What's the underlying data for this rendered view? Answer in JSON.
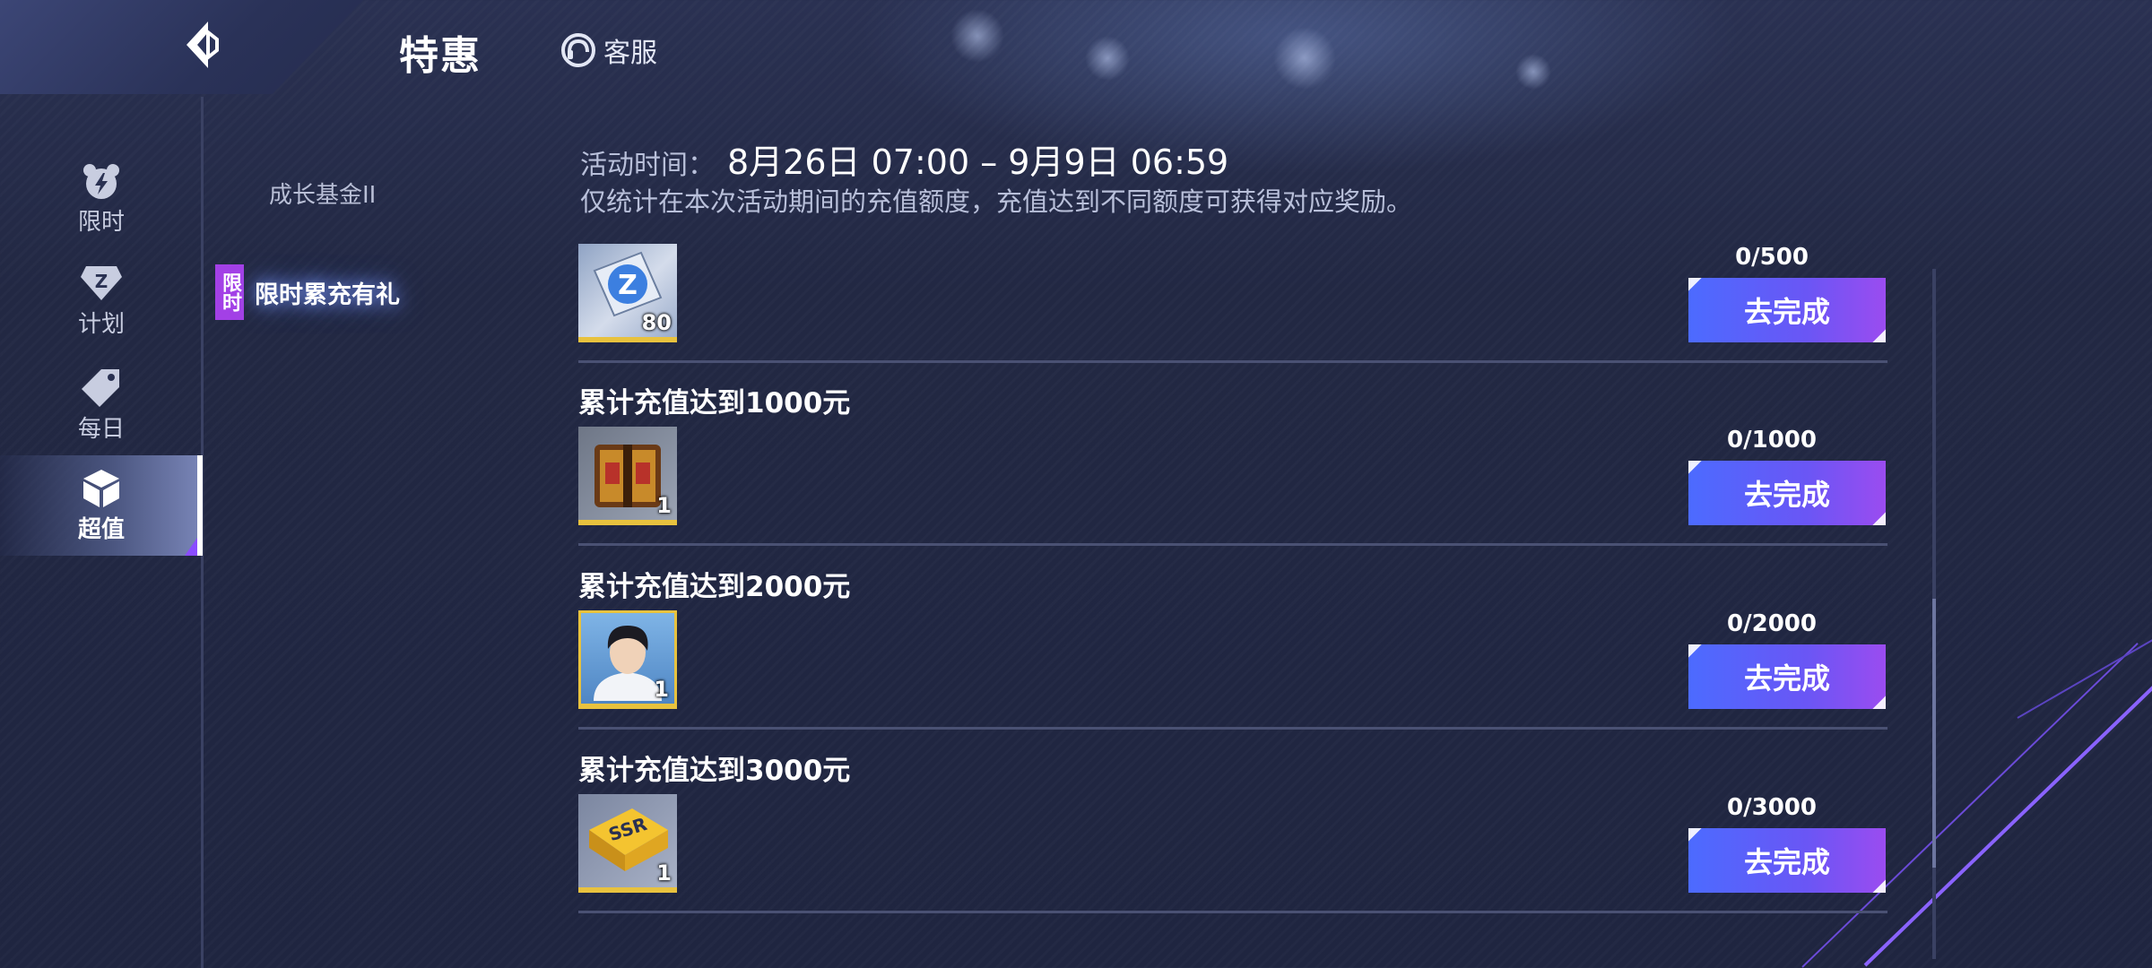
{
  "header": {
    "title": "特惠",
    "service_label": "客服"
  },
  "tabs": [
    {
      "label": "限时",
      "icon": "lightning-bear-icon",
      "active": false
    },
    {
      "label": "计划",
      "icon": "diamond-z-icon",
      "active": false
    },
    {
      "label": "每日",
      "icon": "tag-icon",
      "active": false
    },
    {
      "label": "超值",
      "icon": "cube-icon",
      "active": true
    }
  ],
  "submenu": {
    "items": [
      {
        "label": "成长基金II",
        "active": false
      },
      {
        "label": "限时累充有礼",
        "active": true,
        "badge": "限时"
      }
    ]
  },
  "event": {
    "time_label": "活动时间：",
    "time_value": "8月26日 07:00 – 9月9日 06:59",
    "description": "仅统计在本次活动期间的充值额度，充值达到不同额度可获得对应奖励。"
  },
  "tasks": [
    {
      "title": "",
      "reward": {
        "icon": "z-card-icon",
        "count": "80"
      },
      "progress": "0/500",
      "button": "去完成"
    },
    {
      "title": "累计充值达到1000元",
      "reward": {
        "icon": "treasure-chest-icon",
        "count": "1"
      },
      "progress": "0/1000",
      "button": "去完成"
    },
    {
      "title": "累计充值达到2000元",
      "reward": {
        "icon": "player-portrait-icon",
        "count": "1"
      },
      "progress": "0/2000",
      "button": "去完成"
    },
    {
      "title": "累计充值达到3000元",
      "reward": {
        "icon": "ssr-case-icon",
        "count": "1"
      },
      "progress": "0/3000",
      "button": "去完成"
    }
  ],
  "colors": {
    "accent_blue": "#4c6bff",
    "accent_purple": "#9b4cf0",
    "badge_purple": "#a340e6",
    "item_border": "#e8c23e"
  }
}
